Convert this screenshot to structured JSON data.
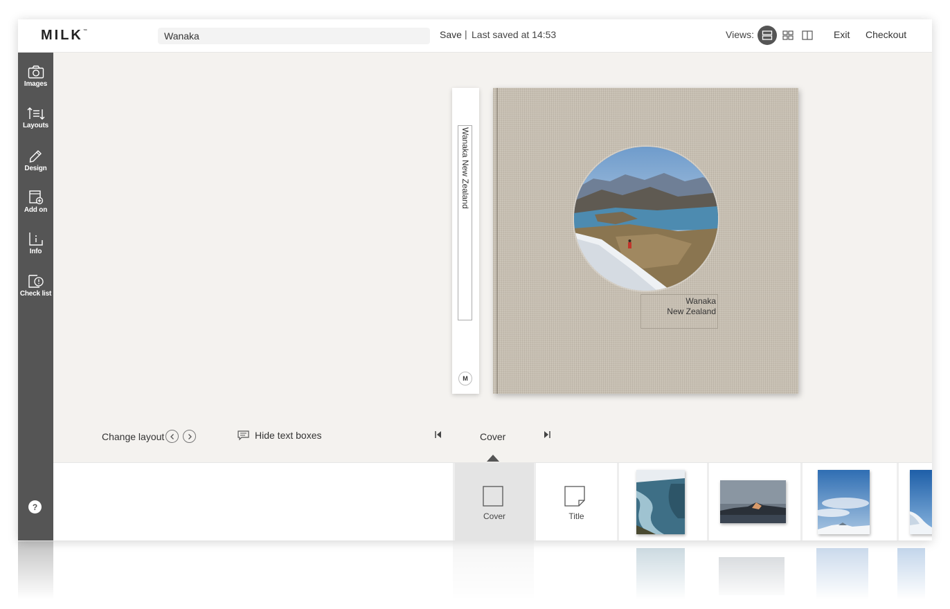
{
  "header": {
    "logo": "MILK",
    "logo_tm": "™",
    "project_name": "Wanaka",
    "save_label": "Save",
    "separator": "|",
    "last_saved": "Last saved at 14:53",
    "views_label": "Views:",
    "exit_label": "Exit",
    "checkout_label": "Checkout"
  },
  "sidebar": {
    "items": [
      {
        "label": "Images",
        "icon": "camera-icon"
      },
      {
        "label": "Layouts",
        "icon": "layouts-icon"
      },
      {
        "label": "Design",
        "icon": "pencil-icon"
      },
      {
        "label": "Add on",
        "icon": "add-on-icon"
      },
      {
        "label": "Info",
        "icon": "info-icon"
      },
      {
        "label": "Check list",
        "icon": "checklist-icon"
      }
    ],
    "help_label": "?"
  },
  "book": {
    "spine_text": "Wanaka New Zealand",
    "spine_logo": "M",
    "cover_title_line1": "Wanaka",
    "cover_title_line2": "New Zealand",
    "cover_color": "#c7bfb2"
  },
  "controls": {
    "change_layout_label": "Change layout",
    "hide_text_label": "Hide text boxes",
    "current_page": "Cover"
  },
  "filmstrip": {
    "items": [
      {
        "label": "Cover",
        "selected": true
      },
      {
        "label": "Title",
        "selected": false
      }
    ]
  },
  "colors": {
    "sidebar": "#555555",
    "canvas": "#f4f2ef",
    "active_view": "#555555"
  }
}
